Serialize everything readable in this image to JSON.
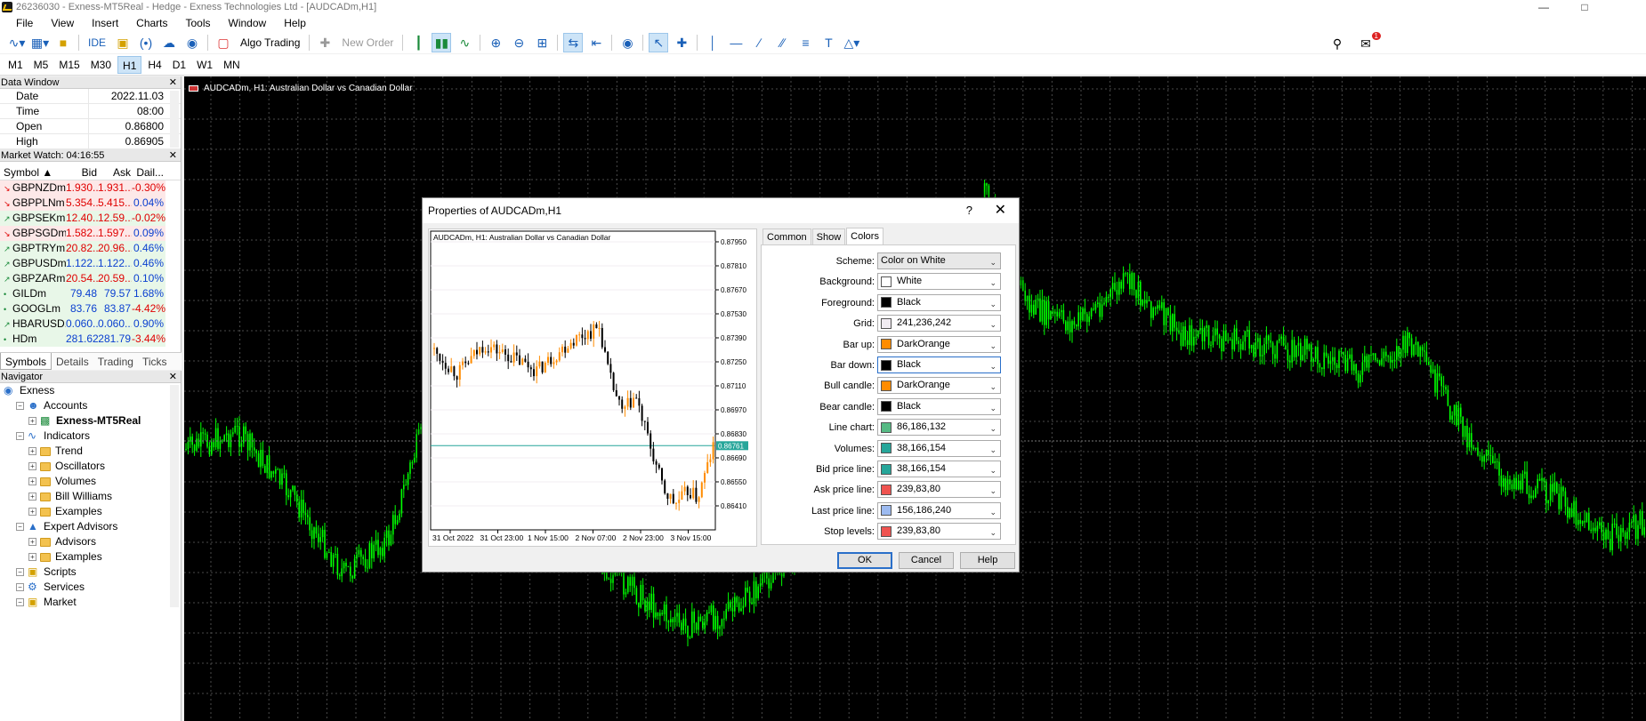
{
  "window": {
    "title": "26236030 - Exness-MT5Real - Hedge - Exness Technologies Ltd - [AUDCADm,H1]"
  },
  "menu": [
    "File",
    "View",
    "Insert",
    "Charts",
    "Tools",
    "Window",
    "Help"
  ],
  "toolbar": {
    "ide": "IDE",
    "algo_trading": "Algo Trading",
    "new_order": "New Order"
  },
  "timeframes": [
    "M1",
    "M5",
    "M15",
    "M30",
    "H1",
    "H4",
    "D1",
    "W1",
    "MN"
  ],
  "active_timeframe": "H1",
  "notification_count": "1",
  "data_window": {
    "title": "Data Window",
    "rows": [
      {
        "k": "Date",
        "v": "2022.11.03"
      },
      {
        "k": "Time",
        "v": "08:00"
      },
      {
        "k": "Open",
        "v": "0.86800"
      },
      {
        "k": "High",
        "v": "0.86905"
      }
    ]
  },
  "market_watch": {
    "title": "Market Watch: 04:16:55",
    "headers": {
      "symbol": "Symbol",
      "bid": "Bid",
      "ask": "Ask",
      "daily": "Dail..."
    },
    "rows": [
      {
        "sym": "GBPNZDm",
        "bid": "1.930...",
        "ask": "1.931...",
        "d": "-0.30%",
        "dir": "down"
      },
      {
        "sym": "GBPPLNm",
        "bid": "5.354...",
        "ask": "5.415...",
        "d": "0.04%",
        "dir": "down"
      },
      {
        "sym": "GBPSEKm",
        "bid": "12.40...",
        "ask": "12.59...",
        "d": "-0.02%",
        "dir": "up"
      },
      {
        "sym": "GBPSGDm",
        "bid": "1.582...",
        "ask": "1.597...",
        "d": "0.09%",
        "dir": "down"
      },
      {
        "sym": "GBPTRYm",
        "bid": "20.82...",
        "ask": "20.96...",
        "d": "0.46%",
        "dir": "up"
      },
      {
        "sym": "GBPUSDm",
        "bid": "1.122...",
        "ask": "1.122...",
        "d": "0.46%",
        "dir": "up"
      },
      {
        "sym": "GBPZARm",
        "bid": "20.54...",
        "ask": "20.59...",
        "d": "0.10%",
        "dir": "up"
      },
      {
        "sym": "GILDm",
        "bid": "79.48",
        "ask": "79.57",
        "d": "1.68%",
        "dir": "dot"
      },
      {
        "sym": "GOOGLm",
        "bid": "83.76",
        "ask": "83.87",
        "d": "-4.42%",
        "dir": "dot"
      },
      {
        "sym": "HBARUSD...",
        "bid": "0.060...",
        "ask": "0.060...",
        "d": "0.90%",
        "dir": "up"
      },
      {
        "sym": "HDm",
        "bid": "281.62",
        "ask": "281.79",
        "d": "-3.44%",
        "dir": "dot"
      }
    ],
    "tabs": [
      "Symbols",
      "Details",
      "Trading",
      "Ticks"
    ]
  },
  "navigator": {
    "title": "Navigator",
    "items": [
      {
        "label": "Exness",
        "level": 0,
        "kind": "broker"
      },
      {
        "label": "Accounts",
        "level": 1,
        "kind": "accounts"
      },
      {
        "label": "Exness-MT5Real",
        "level": 2,
        "kind": "account"
      },
      {
        "label": "Indicators",
        "level": 1,
        "kind": "indicators"
      },
      {
        "label": "Trend",
        "level": 2,
        "kind": "folder"
      },
      {
        "label": "Oscillators",
        "level": 2,
        "kind": "folder"
      },
      {
        "label": "Volumes",
        "level": 2,
        "kind": "folder"
      },
      {
        "label": "Bill Williams",
        "level": 2,
        "kind": "folder"
      },
      {
        "label": "Examples",
        "level": 2,
        "kind": "folder"
      },
      {
        "label": "Expert Advisors",
        "level": 1,
        "kind": "experts"
      },
      {
        "label": "Advisors",
        "level": 2,
        "kind": "folder"
      },
      {
        "label": "Examples",
        "level": 2,
        "kind": "folder"
      },
      {
        "label": "Scripts",
        "level": 1,
        "kind": "scripts"
      },
      {
        "label": "Services",
        "level": 1,
        "kind": "services"
      },
      {
        "label": "Market",
        "level": 1,
        "kind": "market"
      }
    ]
  },
  "chart": {
    "title": "AUDCADm, H1:  Australian Dollar vs Canadian Dollar"
  },
  "dialog": {
    "title": "Properties of AUDCADm,H1",
    "help_glyph": "?",
    "tabs": [
      "Common",
      "Show",
      "Colors"
    ],
    "active_tab": "Colors",
    "preview": {
      "title": "AUDCADm, H1:  Australian Dollar vs Canadian Dollar",
      "price_ticks": [
        "0.87950",
        "0.87810",
        "0.87670",
        "0.87530",
        "0.87390",
        "0.87250",
        "0.87110",
        "0.86970",
        "0.86830",
        "0.86690",
        "0.86550",
        "0.86410"
      ],
      "current_price": "0.86761",
      "time_ticks": [
        "31 Oct 2022",
        "31 Oct 23:00",
        "1 Nov 15:00",
        "2 Nov 07:00",
        "2 Nov 23:00",
        "3 Nov 15:00"
      ]
    },
    "rows": [
      {
        "label": "Scheme:",
        "value": "Color on White",
        "swatch": null
      },
      {
        "label": "Background:",
        "value": "White",
        "swatch": "#ffffff"
      },
      {
        "label": "Foreground:",
        "value": "Black",
        "swatch": "#000000"
      },
      {
        "label": "Grid:",
        "value": "241,236,242",
        "swatch": "#f1ecf2"
      },
      {
        "label": "Bar up:",
        "value": "DarkOrange",
        "swatch": "#ff8c00"
      },
      {
        "label": "Bar down:",
        "value": "Black",
        "swatch": "#000000"
      },
      {
        "label": "Bull candle:",
        "value": "DarkOrange",
        "swatch": "#ff8c00"
      },
      {
        "label": "Bear candle:",
        "value": "Black",
        "swatch": "#000000"
      },
      {
        "label": "Line chart:",
        "value": "86,186,132",
        "swatch": "#56ba84"
      },
      {
        "label": "Volumes:",
        "value": "38,166,154",
        "swatch": "#26a69a"
      },
      {
        "label": "Bid price line:",
        "value": "38,166,154",
        "swatch": "#26a69a"
      },
      {
        "label": "Ask price line:",
        "value": "239,83,80",
        "swatch": "#ef5350"
      },
      {
        "label": "Last price line:",
        "value": "156,186,240",
        "swatch": "#9cbaf0"
      },
      {
        "label": "Stop levels:",
        "value": "239,83,80",
        "swatch": "#ef5350"
      }
    ],
    "buttons": {
      "ok": "OK",
      "cancel": "Cancel",
      "help": "Help"
    }
  },
  "colors": {
    "chart_bg": "#000000",
    "candle_green": "#00ff00",
    "accent": "#2a6fc9",
    "down": "#e00000",
    "up": "#0a3fd0"
  }
}
